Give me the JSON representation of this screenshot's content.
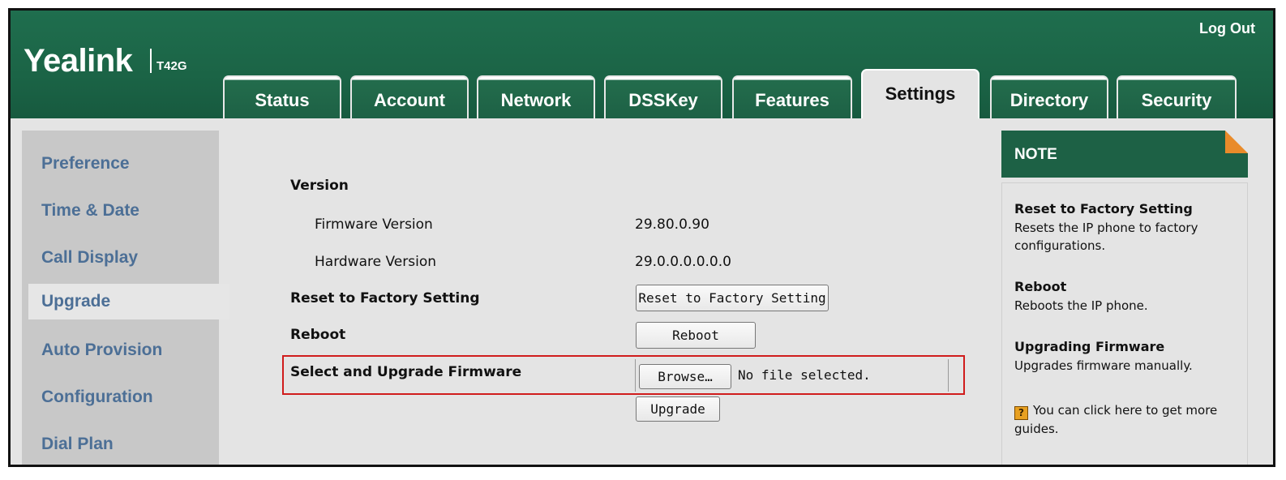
{
  "header": {
    "brand": "Yealink",
    "model": "T42G",
    "logout_label": "Log Out"
  },
  "tabs": [
    {
      "label": "Status",
      "active": false
    },
    {
      "label": "Account",
      "active": false
    },
    {
      "label": "Network",
      "active": false
    },
    {
      "label": "DSSKey",
      "active": false
    },
    {
      "label": "Features",
      "active": false
    },
    {
      "label": "Settings",
      "active": true
    },
    {
      "label": "Directory",
      "active": false
    },
    {
      "label": "Security",
      "active": false
    }
  ],
  "sidebar": {
    "items": [
      {
        "label": "Preference",
        "active": false
      },
      {
        "label": "Time & Date",
        "active": false
      },
      {
        "label": "Call Display",
        "active": false
      },
      {
        "label": "Upgrade",
        "active": true
      },
      {
        "label": "Auto Provision",
        "active": false
      },
      {
        "label": "Configuration",
        "active": false
      },
      {
        "label": "Dial Plan",
        "active": false
      }
    ]
  },
  "main": {
    "version_heading": "Version",
    "firmware_version_label": "Firmware Version",
    "firmware_version_value": "29.80.0.90",
    "hardware_version_label": "Hardware Version",
    "hardware_version_value": "29.0.0.0.0.0.0",
    "reset_label": "Reset to Factory Setting",
    "reset_button": "Reset to Factory Setting",
    "reboot_label": "Reboot",
    "reboot_button": "Reboot",
    "upgrade_label": "Select and Upgrade Firmware",
    "browse_button": "Browse…",
    "file_status": "No file selected.",
    "upgrade_button": "Upgrade"
  },
  "note": {
    "heading": "NOTE",
    "reset_title": "Reset to Factory Setting",
    "reset_text": "Resets the IP phone to factory configurations.",
    "reboot_title": "Reboot",
    "reboot_text": "Reboots the IP phone.",
    "upgrade_title": "Upgrading Firmware",
    "upgrade_text": "Upgrades firmware manually.",
    "guide_icon_glyph": "?",
    "guide_text": "You can click here to get more guides."
  },
  "colors": {
    "header_green": "#1d6145",
    "sidebar_link": "#4c6f96",
    "highlight_red": "#d01c1c",
    "note_corner_orange": "#e98b2a"
  }
}
